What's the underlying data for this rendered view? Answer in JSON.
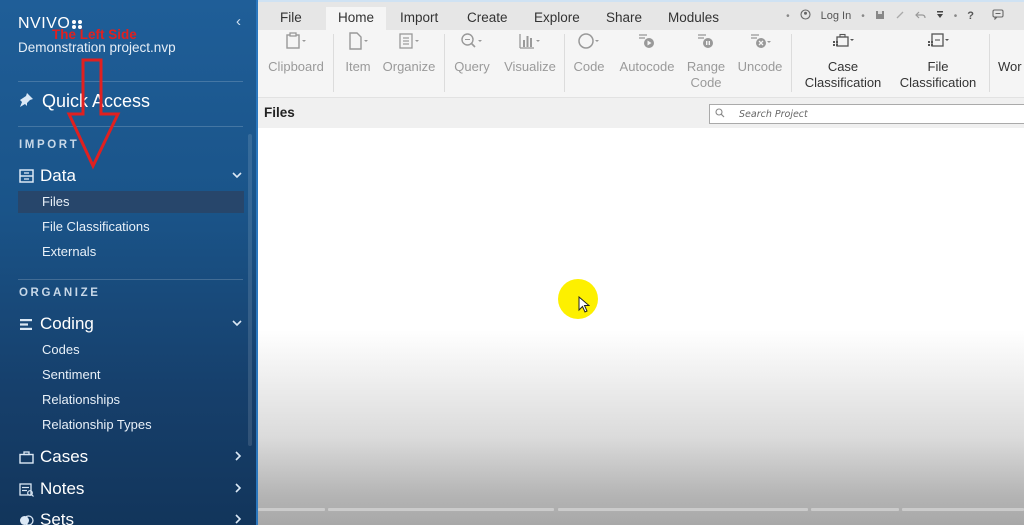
{
  "app": {
    "brand": "NVIVO",
    "project_name": "Demonstration project.nvp",
    "collapse_glyph": "‹"
  },
  "annotation": {
    "text": "The Left Side",
    "color": "#e02020"
  },
  "sidebar": {
    "quick_access": "Quick Access",
    "sections": [
      {
        "label": "IMPORT",
        "groups": [
          {
            "label": "Data",
            "icon": "data-drawer-icon",
            "expanded": true,
            "items": [
              {
                "label": "Files",
                "active": true
              },
              {
                "label": "File Classifications",
                "active": false
              },
              {
                "label": "Externals",
                "active": false
              }
            ]
          }
        ]
      },
      {
        "label": "ORGANIZE",
        "groups": [
          {
            "label": "Coding",
            "icon": "coding-lines-icon",
            "expanded": true,
            "items": [
              {
                "label": "Codes"
              },
              {
                "label": "Sentiment"
              },
              {
                "label": "Relationships"
              },
              {
                "label": "Relationship Types"
              }
            ]
          },
          {
            "label": "Cases",
            "icon": "briefcase-icon",
            "expanded": false
          },
          {
            "label": "Notes",
            "icon": "notes-icon",
            "expanded": false
          },
          {
            "label": "Sets",
            "icon": "sets-icon",
            "expanded": false
          }
        ]
      }
    ]
  },
  "ribbon": {
    "tabs": [
      "File",
      "Home",
      "Import",
      "Create",
      "Explore",
      "Share",
      "Modules"
    ],
    "active_tab": "Home",
    "right": {
      "login": "Log In",
      "help": "?"
    },
    "buttons": [
      {
        "label": "Clipboard",
        "icon": "clipboard-icon"
      },
      {
        "label": "Item",
        "icon": "document-icon"
      },
      {
        "label": "Organize",
        "icon": "list-clipboard-icon"
      },
      {
        "label": "Query",
        "icon": "magnifier-icon"
      },
      {
        "label": "Visualize",
        "icon": "bar-chart-icon"
      },
      {
        "label": "Code",
        "icon": "circle-icon"
      },
      {
        "label": "Autocode",
        "icon": "autocode-icon"
      },
      {
        "label": "Range Code",
        "line1": "Range",
        "line2": "Code",
        "icon": "range-code-icon"
      },
      {
        "label": "Uncode",
        "icon": "uncode-icon"
      },
      {
        "label": "Case Classification",
        "line1": "Case",
        "line2": "Classification",
        "icon": "case-classification-icon"
      },
      {
        "label": "File Classification",
        "line1": "File",
        "line2": "Classification",
        "icon": "file-classification-icon"
      },
      {
        "label": "Wor",
        "icon": ""
      }
    ]
  },
  "files_panel": {
    "title": "Files",
    "search_placeholder": "Search Project"
  }
}
